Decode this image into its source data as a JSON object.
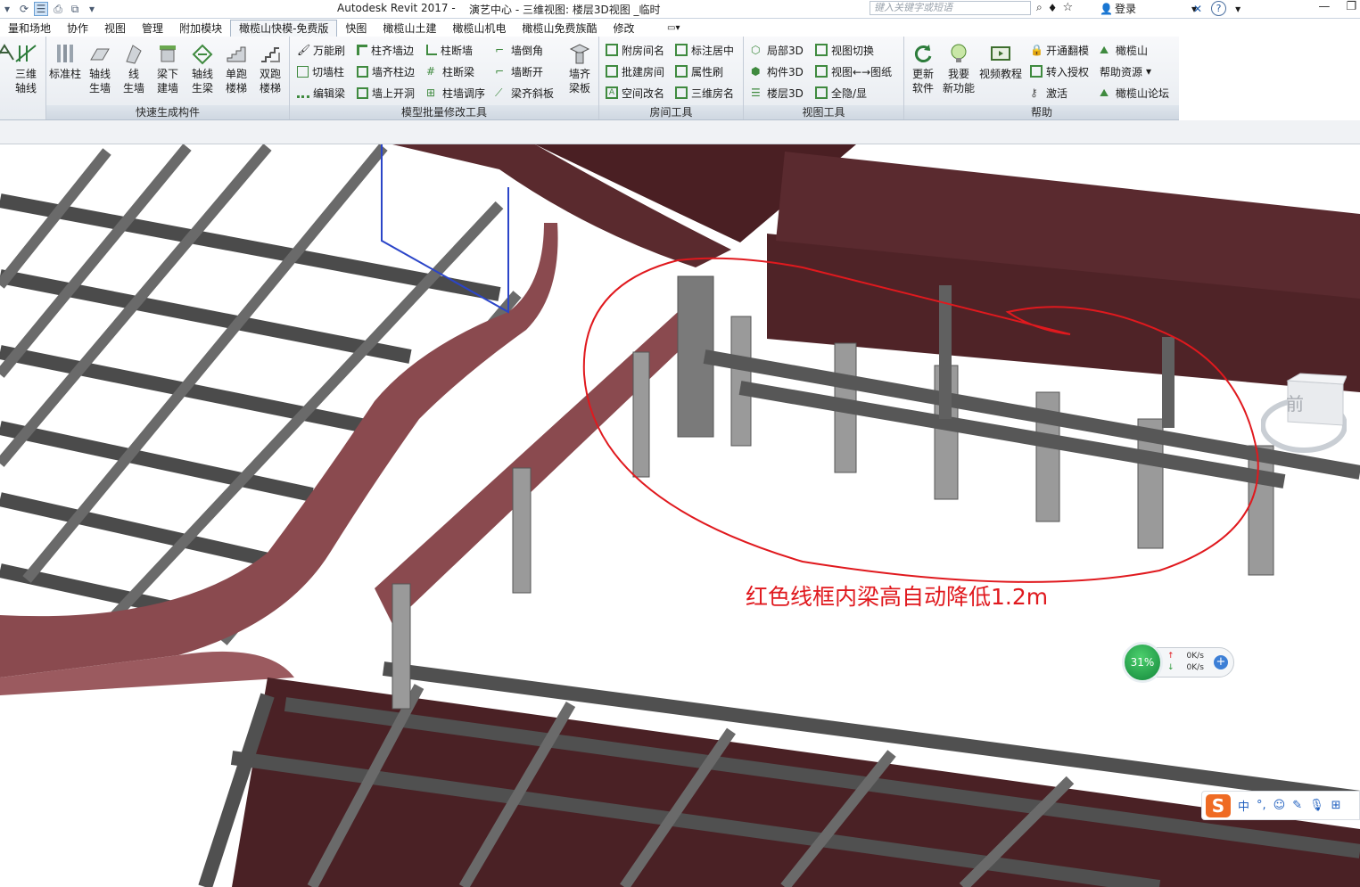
{
  "titlebar": {
    "app_title": "Autodesk Revit 2017 -",
    "doc_title": "演艺中心 - 三维视图: 楼层3D视图 _临时",
    "search_placeholder": "键入关键字或短语",
    "login_label": "登录",
    "qat_icons": [
      "dropdown-icon",
      "sync-icon",
      "thin-lines-icon",
      "print-icon",
      "switch-windows-icon",
      "customize-icon"
    ]
  },
  "tabs": [
    "量和场地",
    "协作",
    "视图",
    "管理",
    "附加模块",
    "橄榄山快模-免费版",
    "快图",
    "橄榄山土建",
    "橄榄山机电",
    "橄榄山免费族酷",
    "修改"
  ],
  "active_tab": "橄榄山快模-免费版",
  "ribbon": {
    "panel_kuaisu": {
      "title": "快速生成构件",
      "buttons": [
        {
          "label1": "三维",
          "label2": "轴线"
        },
        {
          "label1": "标准柱",
          "label2": ""
        },
        {
          "label1": "轴线",
          "label2": "生墙"
        },
        {
          "label1": "线",
          "label2": "生墙"
        },
        {
          "label1": "梁下",
          "label2": "建墙"
        },
        {
          "label1": "轴线",
          "label2": "生梁"
        },
        {
          "label1": "单跑",
          "label2": "楼梯"
        },
        {
          "label1": "双跑",
          "label2": "楼梯"
        }
      ]
    },
    "panel_batch": {
      "title": "模型批量修改工具",
      "col1": [
        "万能刷",
        "切墙柱",
        "编辑梁"
      ],
      "col2": [
        "柱齐墙边",
        "墙齐柱边",
        "墙上开洞"
      ],
      "col3": [
        "柱断墙",
        "柱断梁",
        "柱墙调序"
      ],
      "col4": [
        "墙倒角",
        "墙断开",
        "梁齐斜板"
      ],
      "big": {
        "label1": "墙齐",
        "label2": "梁板"
      }
    },
    "panel_room": {
      "title": "房间工具",
      "col1": [
        "附房间名",
        "批建房间",
        "空间改名"
      ],
      "col2": [
        "标注居中",
        "属性刷",
        "三维房名"
      ]
    },
    "panel_view": {
      "title": "视图工具",
      "col1": [
        "局部3D",
        "构件3D",
        "楼层3D"
      ],
      "col2": [
        "视图切换",
        "视图←→图纸",
        "全隐/显"
      ]
    },
    "panel_help": {
      "title": "帮助",
      "big": [
        {
          "label1": "更新",
          "label2": "软件"
        },
        {
          "label1": "我要",
          "label2": "新功能"
        },
        {
          "label1": "视频教程",
          "label2": ""
        }
      ],
      "col1": [
        "开通翻模",
        "转入授权",
        "激活"
      ],
      "col2": [
        "橄榄山",
        "帮助资源",
        "橄榄山论坛"
      ]
    }
  },
  "viewport": {
    "annotation": "红色线框内梁高自动降低1.2m",
    "nav_cube_label": "前"
  },
  "net_meter": {
    "percent": "31%",
    "up": "0K/s",
    "down": "0K/s"
  },
  "ime": {
    "lang": "中",
    "punct": "°,"
  },
  "colors": {
    "wall": "#8a4a4f",
    "beam": "#6e6e6e",
    "annotation": "#e0191e",
    "column": "#9a9a9a"
  }
}
